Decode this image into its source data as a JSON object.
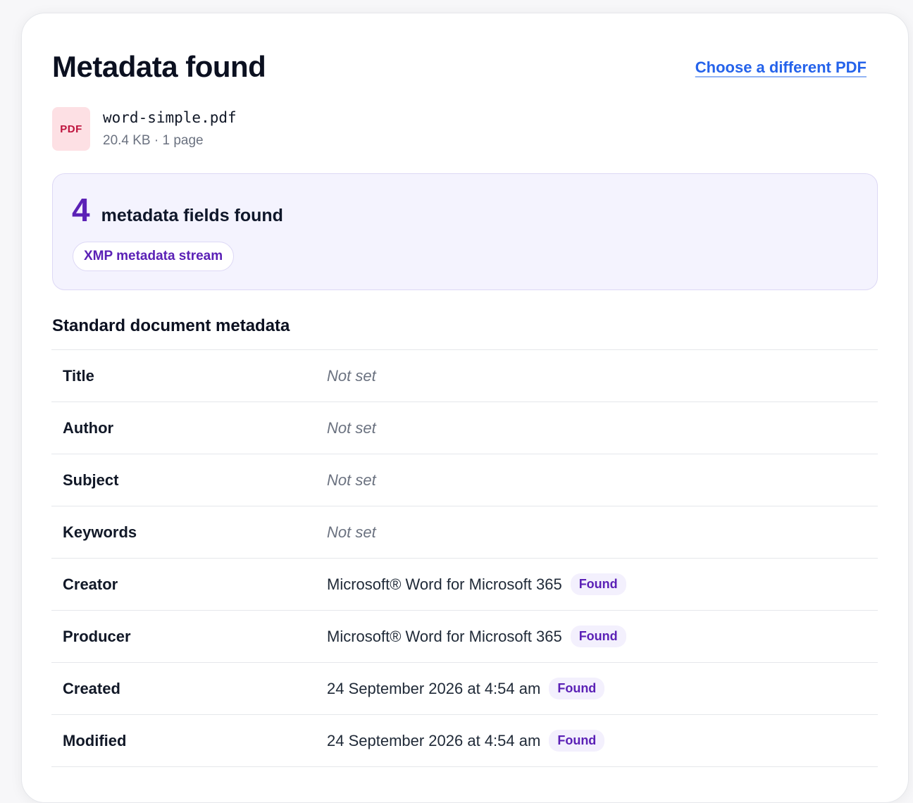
{
  "header": {
    "title": "Metadata found",
    "change_link": "Choose a different PDF"
  },
  "file": {
    "badge": "PDF",
    "name": "word-simple.pdf",
    "details": "20.4 KB · 1 page"
  },
  "summary": {
    "count": "4",
    "label": "metadata fields found",
    "source": "XMP metadata stream"
  },
  "section": {
    "title": "Standard document metadata"
  },
  "rows": [
    {
      "key": "Title",
      "value": "Not set",
      "badge": ""
    },
    {
      "key": "Author",
      "value": "Not set",
      "badge": ""
    },
    {
      "key": "Subject",
      "value": "Not set",
      "badge": ""
    },
    {
      "key": "Keywords",
      "value": "Not set",
      "badge": ""
    },
    {
      "key": "Creator",
      "value": "Microsoft® Word for Microsoft 365",
      "badge": "Found"
    },
    {
      "key": "Producer",
      "value": "Microsoft® Word for Microsoft 365",
      "badge": "Found"
    },
    {
      "key": "Created",
      "value": "24 September 2026 at 4:54 am",
      "badge": "Found"
    },
    {
      "key": "Modified",
      "value": "24 September 2026 at 4:54 am",
      "badge": "Found"
    }
  ],
  "colors": {
    "accent": "#5b21b6",
    "link": "#2563eb",
    "pdf_badge_bg": "#fde0e4",
    "pdf_badge_text": "#be123c"
  }
}
